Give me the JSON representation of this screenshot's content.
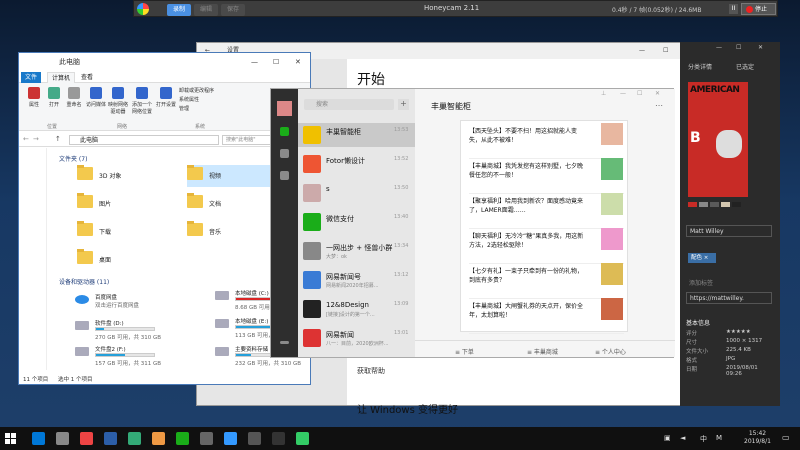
{
  "honeycam": {
    "title": "Honeycam 2.11",
    "tabs": [
      "录制",
      "编辑",
      "保存"
    ],
    "stats": "0.4秒 / 7 帧(0.052秒) / 24.6MB",
    "pause_label": "II",
    "stop_label": "停止"
  },
  "settings": {
    "title": "设置",
    "heading": "开始",
    "help_text": "获取帮助",
    "improve_text": "让 Windows 变得更好"
  },
  "explorer": {
    "title": "此电脑",
    "ribbon_tabs": [
      "文件",
      "计算机",
      "查看"
    ],
    "ribbon_buttons": [
      {
        "label": "属性",
        "color": "#c33"
      },
      {
        "label": "打开",
        "color": "#4a8"
      },
      {
        "label": "重命名",
        "color": "#999"
      },
      {
        "label": "访问媒体",
        "color": "#36c"
      },
      {
        "label": "映射网络驱动器",
        "color": "#36c"
      },
      {
        "label": "添加一个网络位置",
        "color": "#36c"
      },
      {
        "label": "打开设置",
        "color": "#36c"
      }
    ],
    "ribbon_links": [
      "卸载或更改程序",
      "系统属性",
      "管理"
    ],
    "ribbon_groups": [
      "位置",
      "网络",
      "系统"
    ],
    "address": "此电脑",
    "search_placeholder": "搜索\"此电脑\"",
    "folders_header": "文件夹 (7)",
    "folders": [
      "3D 对象",
      "视频",
      "图片",
      "文档",
      "下载",
      "音乐",
      "桌面"
    ],
    "drives_header": "设备和驱动器 (11)",
    "drives": [
      {
        "name": "百度网盘",
        "size": "双击运行百度网盘",
        "fill": 0,
        "warn": false
      },
      {
        "name": "本地磁盘 (C:)",
        "size": "8.68 GB 可用，共 97.6 GB",
        "fill": 0.91,
        "warn": true
      },
      {
        "name": "软件盘 (D:)",
        "size": "270 GB 可用，共 310 GB",
        "fill": 0.13,
        "warn": false
      },
      {
        "name": "本地磁盘 (E:)",
        "size": "113 GB 可用，共 310 GB",
        "fill": 0.64,
        "warn": false
      },
      {
        "name": "文件盘2 (F:)",
        "size": "157 GB 可用，共 311 GB",
        "fill": 0.5,
        "warn": false
      },
      {
        "name": "主要资料存储 (G:)",
        "size": "232 GB 可用，共 310 GB",
        "fill": 0.25,
        "warn": false
      }
    ],
    "status_count": "11 个项目",
    "status_selected": "选中 1 个项目"
  },
  "wechat": {
    "search_placeholder": "搜索",
    "chats": [
      {
        "name": "丰巢智能柜",
        "preview": "",
        "time": "13:53",
        "color": "#f0c000"
      },
      {
        "name": "Fotor懒设计",
        "preview": "",
        "time": "13:52",
        "color": "#e53"
      },
      {
        "name": "s",
        "preview": "",
        "time": "13:50",
        "color": "#caa"
      },
      {
        "name": "微信支付",
        "preview": "",
        "time": "13:40",
        "color": "#1aad19"
      },
      {
        "name": "一网出步 + 怪兽小群",
        "preview": "大梦：ok",
        "time": "13:34",
        "color": "#888"
      },
      {
        "name": "网易新闻号",
        "preview": "网易新闻2020年招募...",
        "time": "13:12",
        "color": "#3a7bd5"
      },
      {
        "name": "12&8Design",
        "preview": "[链接]设计的第一个...",
        "time": "13:09",
        "color": "#222"
      },
      {
        "name": "网易新闻",
        "preview": "八一：目前，2020欧洲杯...",
        "time": "13:01",
        "color": "#d33"
      }
    ],
    "chat_title": "丰巢智能柜",
    "articles": [
      {
        "text": "【西天坠头】不要不扫！用这招就能人变失，从此不被难！",
        "color": "#e8b7a0"
      },
      {
        "text": "【丰巢商城】我凭发挖有这样别墅，七夕晚餐任您的不一般！",
        "color": "#6b7"
      },
      {
        "text": "【聚享福利】哈用我到新农？面度感动竟来了，LAMER面霜……",
        "color": "#cda"
      },
      {
        "text": "【聊天福利】无冷冷“糖”果真多我，用这新方法，2选轻松驱除！",
        "color": "#e9c"
      },
      {
        "text": "【七夕有礼】一束子只牵到有一份的礼物，到底有多贵？",
        "color": "#db5"
      },
      {
        "text": "【丰巢商城】大闸蟹礼券的天点开，保价全年，太划算啦！",
        "color": "#c64"
      }
    ],
    "menu": [
      "≡ 下单",
      "≡ 丰巢商城",
      "≡ 个人中心"
    ]
  },
  "photo": {
    "tabs": [
      "分类详情",
      "已选定"
    ],
    "cover_text": "AMERICAN",
    "cover_letter": "B",
    "swatches": [
      "#c82b26",
      "#888888",
      "#5a5a5a",
      "#d4c7b0",
      "#222222"
    ],
    "author": "Matt Willey",
    "tag": "配色 ×",
    "add_tag_placeholder": "添加标签",
    "url": "https://mattwilley.",
    "info_title": "基本信息",
    "info": [
      {
        "k": "评分",
        "v": "★★★★★"
      },
      {
        "k": "尺寸",
        "v": "1000 × 1317"
      },
      {
        "k": "文件大小",
        "v": "225.4 KB"
      },
      {
        "k": "格式",
        "v": "JPG"
      },
      {
        "k": "日期",
        "v": "2019/08/01 09:26"
      }
    ]
  },
  "taskbar": {
    "apps": [
      "#0078d7",
      "#888",
      "#e44",
      "#2c5ea8",
      "#3a7",
      "#e94",
      "#1aad19",
      "#666",
      "#39f",
      "#555",
      "#333",
      "#3c6"
    ],
    "tray_ime": "中",
    "tray_m": "M",
    "time": "15:42",
    "date": "2019/8/1"
  }
}
